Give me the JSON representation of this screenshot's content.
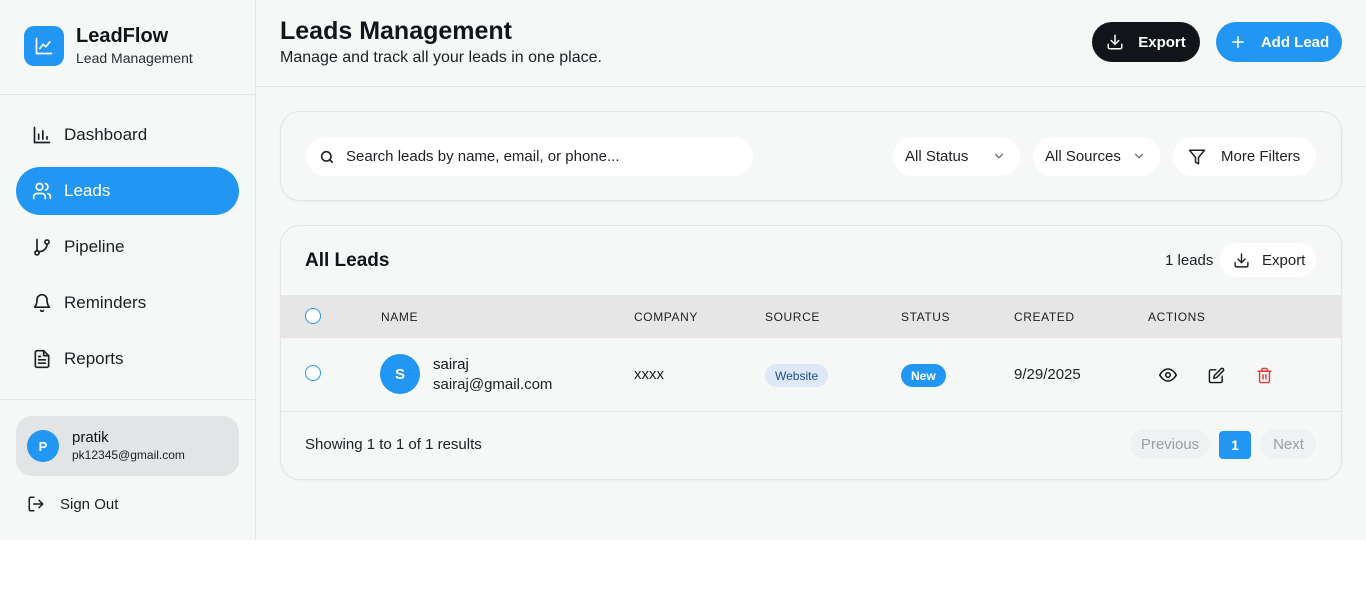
{
  "brand": {
    "name": "LeadFlow",
    "subtitle": "Lead Management",
    "logo_icon": "chart-line-icon"
  },
  "sidebar": {
    "items": [
      {
        "label": "Dashboard",
        "icon": "bar-chart-icon",
        "active": false
      },
      {
        "label": "Leads",
        "icon": "users-icon",
        "active": true
      },
      {
        "label": "Pipeline",
        "icon": "git-branch-icon",
        "active": false
      },
      {
        "label": "Reminders",
        "icon": "bell-icon",
        "active": false
      },
      {
        "label": "Reports",
        "icon": "file-text-icon",
        "active": false
      }
    ],
    "user": {
      "initial": "P",
      "name": "pratik",
      "email": "pk12345@gmail.com"
    },
    "signout_label": "Sign Out"
  },
  "header": {
    "title": "Leads Management",
    "subtitle": "Manage and track all your leads in one place.",
    "export_label": "Export",
    "add_label": "Add Lead"
  },
  "filters": {
    "search_placeholder": "Search leads by name, email, or phone...",
    "status_value": "All Status",
    "source_value": "All Sources",
    "more_label": "More Filters"
  },
  "leads": {
    "title": "All Leads",
    "count_label": "1 leads",
    "export_label": "Export",
    "columns": [
      "NAME",
      "COMPANY",
      "SOURCE",
      "STATUS",
      "CREATED",
      "ACTIONS"
    ],
    "rows": [
      {
        "initial": "S",
        "name": "sairaj",
        "email": "sairaj@gmail.com",
        "company": "xxxx",
        "source": "Website",
        "status": "New",
        "created": "9/29/2025"
      }
    ],
    "showing": "Showing 1 to 1 of 1 results",
    "pagination": {
      "previous": "Previous",
      "current": "1",
      "next": "Next"
    }
  },
  "colors": {
    "accent": "#2196f3",
    "dark": "#111418",
    "danger": "#e53935",
    "background": "#f6f7f7"
  }
}
